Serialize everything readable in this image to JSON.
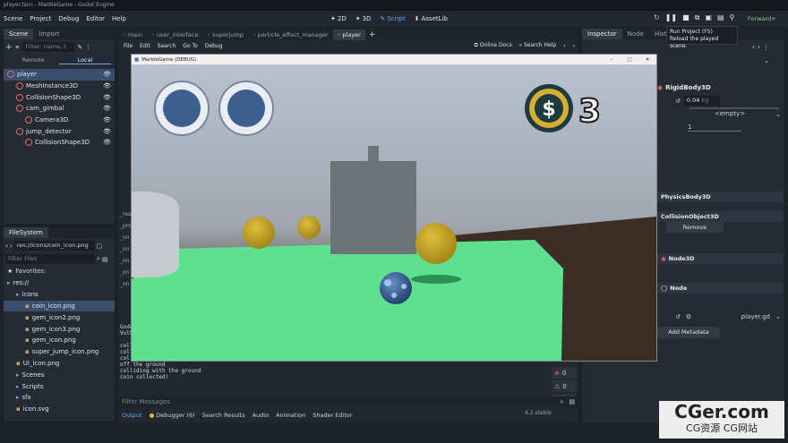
{
  "window_title": "player.tscn - MarbleGame - Godot Engine",
  "menu": [
    "Scene",
    "Project",
    "Debug",
    "Editor",
    "Help"
  ],
  "workspaces": {
    "d2": "2D",
    "d3": "3D",
    "script": "Script",
    "assetlib": "AssetLib"
  },
  "renderer": "Forward+",
  "tooltip": {
    "line1": "Run Project (F5)",
    "line2": "Reload the played scene."
  },
  "scene_dock": {
    "tabs": [
      "Scene",
      "Import"
    ],
    "filter_placeholder": "Filter: name, t",
    "remote": "Remote",
    "local": "Local",
    "nodes": [
      {
        "name": "player",
        "indent": 0,
        "color": "#e06c6c"
      },
      {
        "name": "MeshInstance3D",
        "indent": 1,
        "color": "#e06c6c"
      },
      {
        "name": "CollisionShape3D",
        "indent": 1,
        "color": "#e06c6c"
      },
      {
        "name": "cam_gimbal",
        "indent": 1,
        "color": "#e06c6c"
      },
      {
        "name": "Camera3D",
        "indent": 2,
        "color": "#e06c6c"
      },
      {
        "name": "jump_detector",
        "indent": 1,
        "color": "#e06c6c"
      },
      {
        "name": "CollisionShape3D",
        "indent": 2,
        "color": "#e06c6c"
      }
    ]
  },
  "filesystem": {
    "title": "FileSystem",
    "path": "res://icons/coin_icon.png",
    "filter_placeholder": "Filter Files",
    "favorites": "Favorites:",
    "items": [
      {
        "name": "res://",
        "indent": 0
      },
      {
        "name": "icons",
        "indent": 1
      },
      {
        "name": "coin_icon.png",
        "indent": 2
      },
      {
        "name": "gem_icon2.png",
        "indent": 2
      },
      {
        "name": "gem_icon3.png",
        "indent": 2
      },
      {
        "name": "gem_icon.png",
        "indent": 2
      },
      {
        "name": "super_jump_icon.png",
        "indent": 2
      },
      {
        "name": "UI_icon.png",
        "indent": 1
      },
      {
        "name": "Scenes",
        "indent": 1
      },
      {
        "name": "Scripts",
        "indent": 1
      },
      {
        "name": "sfx",
        "indent": 1
      },
      {
        "name": "icon.svg",
        "indent": 1
      }
    ]
  },
  "editor_tabs": [
    "main",
    "user_interface",
    "superjump",
    "particle_effect_manager",
    "player"
  ],
  "script_menu": [
    "File",
    "Edit",
    "Search",
    "Go To",
    "Debug"
  ],
  "online_docs": "Online Docs",
  "search_help": "Search Help",
  "script_list_fragments": [
    "_rea",
    "_pro",
    "_on",
    "_on",
    "_on",
    "_on",
    "_on"
  ],
  "console_lines": [
    "Godo",
    "Vulk",
    "",
    "coll",
    "coll",
    "coll",
    "off the ground",
    "colliding with the ground",
    "coin collected!"
  ],
  "bottom": {
    "filter": "Filter Messages",
    "tabs": [
      "Output",
      "Debugger (6)",
      "Search Results",
      "Audio",
      "Animation",
      "Shader Editor"
    ],
    "version": "4.2.stable",
    "counts": {
      "errors": "0",
      "warnings": "0",
      "other": "0"
    }
  },
  "game_window": {
    "title": "MarbleGame (DEBUG)",
    "coin_count": "3",
    "coin_symbol": "$"
  },
  "inspector": {
    "tabs": [
      "Inspector",
      "Node",
      "History"
    ],
    "rigidbody": "RigidBody3D",
    "mass": "0.04",
    "mass_unit": "kg",
    "empty": "<empty>",
    "one": "1",
    "physics_body": "PhysicsBody3D",
    "collision_object": "CollisionObject3D",
    "remove": "Remove",
    "node3d": "Node3D",
    "node": "Node",
    "script": "player.gd",
    "add_metadata": "Add Metadata"
  },
  "watermark": {
    "big": "CGer.com",
    "small": "CG资源 CG网站"
  }
}
